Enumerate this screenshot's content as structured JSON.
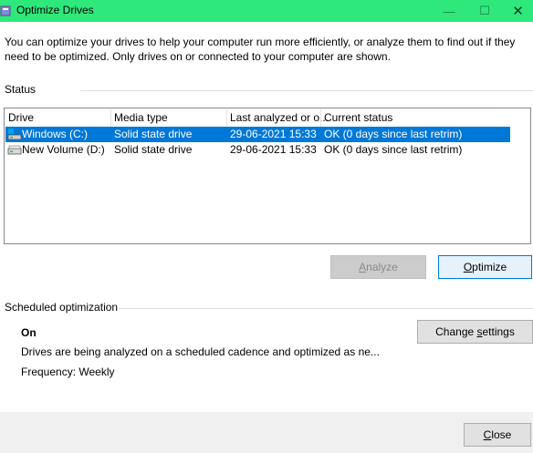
{
  "window": {
    "title": "Optimize Drives",
    "controls": {
      "minimize": "—",
      "maximize": "☐",
      "close": "✕"
    }
  },
  "description": "You can optimize your drives to help your computer run more efficiently, or analyze them to find out if they need to be optimized. Only drives on or connected to your computer are shown.",
  "status": {
    "label": "Status",
    "columns": [
      "Drive",
      "Media type",
      "Last analyzed or o...",
      "Current status"
    ],
    "rows": [
      {
        "drive": "Windows (C:)",
        "media": "Solid state drive",
        "last": "29-06-2021 15:33",
        "status": "OK (0 days since last retrim)",
        "icon": "system-drive-icon",
        "selected": true
      },
      {
        "drive": "New Volume (D:)",
        "media": "Solid state drive",
        "last": "29-06-2021 15:33",
        "status": "OK (0 days since last retrim)",
        "icon": "drive-icon",
        "selected": false
      }
    ],
    "analyze_label_first": "A",
    "analyze_label_rest": "nalyze",
    "optimize_label_first": "O",
    "optimize_label_rest": "ptimize"
  },
  "scheduled": {
    "label": "Scheduled optimization",
    "state": "On",
    "detail": "Drives are being analyzed on a scheduled cadence and optimized as ne...",
    "frequency": "Frequency: Weekly",
    "change_label_pre": "Change ",
    "change_label_u": "s",
    "change_label_post": "ettings"
  },
  "footer": {
    "close_label_first": "C",
    "close_label_rest": "lose"
  },
  "colors": {
    "titlebar": "#2ee87c",
    "selection": "#0078d7",
    "focus_border": "#0078d7"
  }
}
